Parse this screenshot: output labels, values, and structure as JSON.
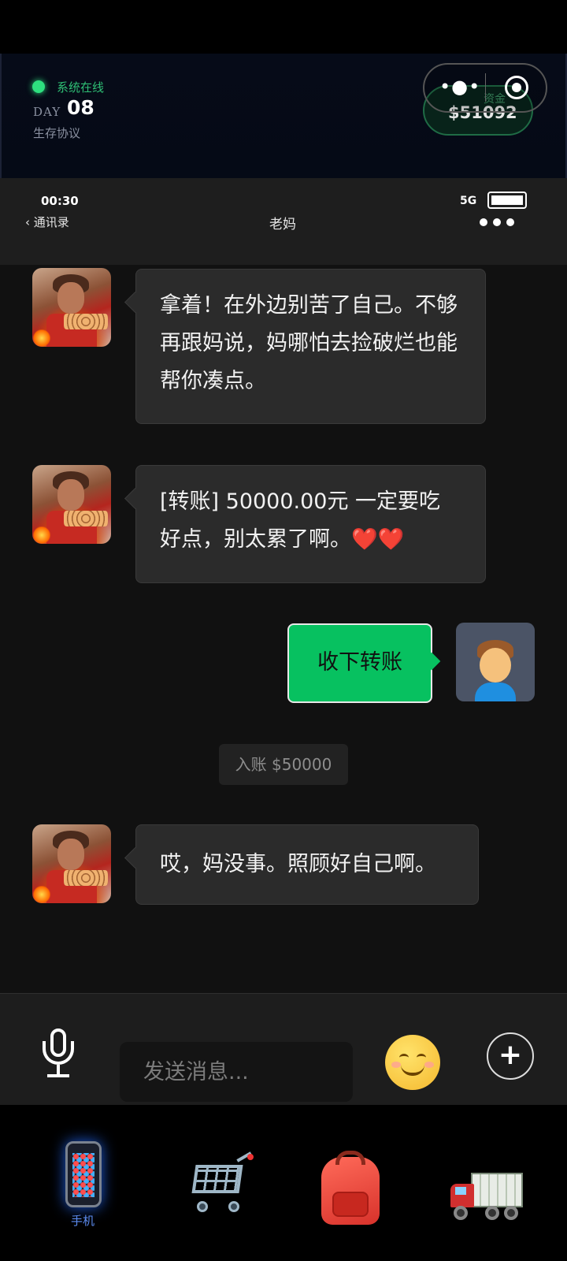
{
  "game_header": {
    "status_text": "系统在线",
    "day_label": "DAY",
    "day_number": "08",
    "subtitle": "生存协议",
    "funds_label": "资金",
    "funds_value": "$51092"
  },
  "phone_status": {
    "time": "00:30",
    "signal": "5G"
  },
  "chat_header": {
    "back_label": "‹ 通讯录",
    "title": "老妈"
  },
  "messages": [
    {
      "sender": "mom",
      "text": "拿着！在外边别苦了自己。不够再跟妈说，妈哪怕去捡破烂也能帮你凑点。"
    },
    {
      "sender": "mom",
      "text": "[转账] 50000.00元 一定要吃好点，别太累了啊。❤️❤️"
    },
    {
      "sender": "me",
      "text": "收下转账"
    },
    {
      "sender": "system",
      "text": "入账 $50000"
    },
    {
      "sender": "mom",
      "text": "哎，妈没事。照顾好自己啊。"
    }
  ],
  "input_bar": {
    "placeholder": "发送消息..."
  },
  "bottom_nav": {
    "items": [
      {
        "icon": "phone-icon",
        "label": "手机",
        "active": true
      },
      {
        "icon": "shopping-cart-icon",
        "label": ""
      },
      {
        "icon": "backpack-icon",
        "label": ""
      },
      {
        "icon": "truck-icon",
        "label": ""
      }
    ]
  },
  "colors": {
    "online": "#2ee07f",
    "accent_green": "#07c160",
    "nav_active": "#5c8cf0"
  }
}
